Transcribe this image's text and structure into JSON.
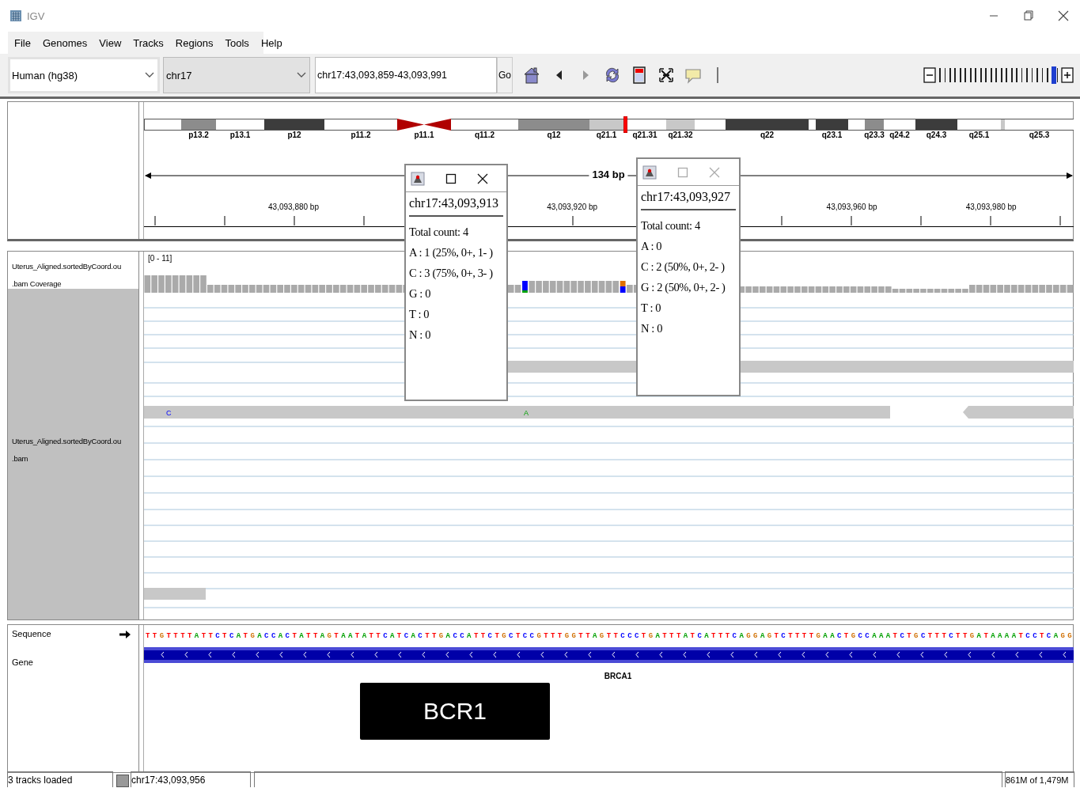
{
  "window": {
    "title": "IGV"
  },
  "menu": [
    "File",
    "Genomes",
    "View",
    "Tracks",
    "Regions",
    "Tools",
    "Help"
  ],
  "toolbar": {
    "genome": "Human (hg38)",
    "chromosome": "chr17",
    "locus": "chr17:43,093,859-43,093,991",
    "go": "Go",
    "forward_enabled": false,
    "zoom": {
      "level": 0.965
    }
  },
  "ideogram": {
    "bands": [
      {
        "kind": "band",
        "color": "#ffffff"
      },
      {
        "kind": "band",
        "label": "p13.2",
        "color": "#8c8c8c"
      },
      {
        "kind": "band",
        "label": "p13.1",
        "color": "#ffffff"
      },
      {
        "kind": "band",
        "label": "p12",
        "color": "#3c3c3c"
      },
      {
        "kind": "band",
        "label": "p11.2",
        "color": "#ffffff"
      },
      {
        "kind": "centromere",
        "label": "p11.1",
        "color": "#b00000"
      },
      {
        "kind": "band",
        "label": "q11.2",
        "color": "#ffffff"
      },
      {
        "kind": "band",
        "label": "q12",
        "color": "#8c8c8c"
      },
      {
        "kind": "band",
        "label": "q21.1",
        "color": "#c8c8c8"
      },
      {
        "kind": "band",
        "label": "q21.31",
        "color": "#ffffff",
        "current": true
      },
      {
        "kind": "band",
        "label": "q21.32",
        "color": "#c8c8c8"
      },
      {
        "kind": "band",
        "color": "#ffffff"
      },
      {
        "kind": "band",
        "label": "q22",
        "color": "#3c3c3c"
      },
      {
        "kind": "band",
        "color": "#ffffff"
      },
      {
        "kind": "band",
        "label": "q23.1",
        "color": "#3c3c3c"
      },
      {
        "kind": "band",
        "color": "#ffffff"
      },
      {
        "kind": "band",
        "label": "q23.3",
        "color": "#8c8c8c"
      },
      {
        "kind": "band",
        "label": "q24.2",
        "color": "#ffffff"
      },
      {
        "kind": "band",
        "label": "q24.3",
        "color": "#3c3c3c"
      },
      {
        "kind": "band",
        "label": "q25.1",
        "color": "#ffffff"
      },
      {
        "kind": "band",
        "color": "#c8c8c8"
      },
      {
        "kind": "band",
        "label": "q25.3",
        "color": "#ffffff"
      }
    ]
  },
  "ruler": {
    "span": "134 bp",
    "ticks": [
      "43,093,880 bp",
      "43,093,920 bp",
      "43,093,960 bp",
      "43,093,980 bp"
    ]
  },
  "tracks": [
    {
      "kind": "coverage",
      "name_lines": [
        "Uterus_Aligned.sortedByCoord.ou",
        ".bam Coverage"
      ],
      "selected": false,
      "range": "[0 - 11]"
    },
    {
      "kind": "alignment",
      "name_lines": [
        "Uterus_Aligned.sortedByCoord.ou",
        ".bam"
      ],
      "selected": true,
      "mismatches": [
        "C",
        "A"
      ]
    }
  ],
  "features": [
    {
      "kind": "sequence",
      "name": "Sequence",
      "sequence": "TTGTTTTATTCTCATGACCACTATTAGTAATATTCATCACTTGACCATTCTGCTCCGTTTGGTTAGTTCCCTGATTTATCATTTCAGGAGTCTTTTGAACTGCCAAATCTGCTTTCTTGATAAAATCCTCAGG"
    },
    {
      "kind": "gene",
      "name": "Gene",
      "gene": "BRCA1"
    }
  ],
  "popups": [
    {
      "active": true,
      "location": "chr17:43,093,913",
      "lines": [
        "Total count: 4",
        "A : 1 (25%, 0+, 1- )",
        "C : 3 (75%, 0+, 3- )",
        "G : 0",
        "T : 0",
        "N : 0"
      ]
    },
    {
      "active": false,
      "location": "chr17:43,093,927",
      "lines": [
        "Total count: 4",
        "A : 0",
        "C : 2 (50%, 0+, 2- )",
        "G : 2 (50%, 0+, 2- )",
        "T : 0",
        "N : 0"
      ]
    }
  ],
  "annotation": {
    "text": "BCR1"
  },
  "status_bar": {
    "tracks": "3 tracks loaded",
    "position": "chr17:43,093,956",
    "memory": "861M of 1,479M"
  }
}
